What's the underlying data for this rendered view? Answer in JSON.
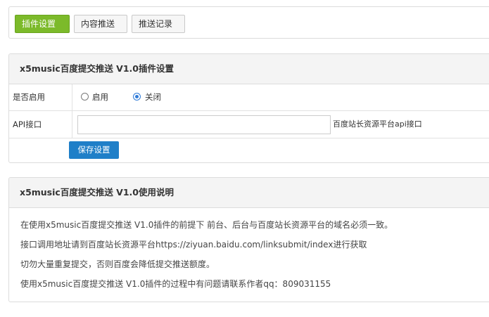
{
  "tabs": [
    {
      "label": "插件设置",
      "active": true
    },
    {
      "label": "内容推送",
      "active": false
    },
    {
      "label": "推送记录",
      "active": false
    }
  ],
  "settings": {
    "title": "x5music百度提交推送 V1.0插件设置",
    "enable_label": "是否启用",
    "enable_on_label": "启用",
    "enable_off_label": "关闭",
    "enable_selected": "关闭",
    "api_label": "API接口",
    "api_value": "",
    "api_hint": "百度站长资源平台api接口",
    "save_label": "保存设置"
  },
  "help": {
    "title": "x5music百度提交推送 V1.0使用说明",
    "lines": [
      "在使用x5music百度提交推送 V1.0插件的前提下 前台、后台与百度站长资源平台的域名必须一致。",
      "接口调用地址请到百度站长资源平台https://ziyuan.baidu.com/linksubmit/index进行获取",
      "切勿大量重复提交，否则百度会降低提交推送额度。",
      "使用x5music百度提交推送 V1.0插件的过程中有问题请联系作者qq：809031155"
    ]
  },
  "colors": {
    "active_tab": "#7cba2a",
    "primary_button": "#1f7fc8",
    "radio_checked": "#2f7bd8"
  }
}
